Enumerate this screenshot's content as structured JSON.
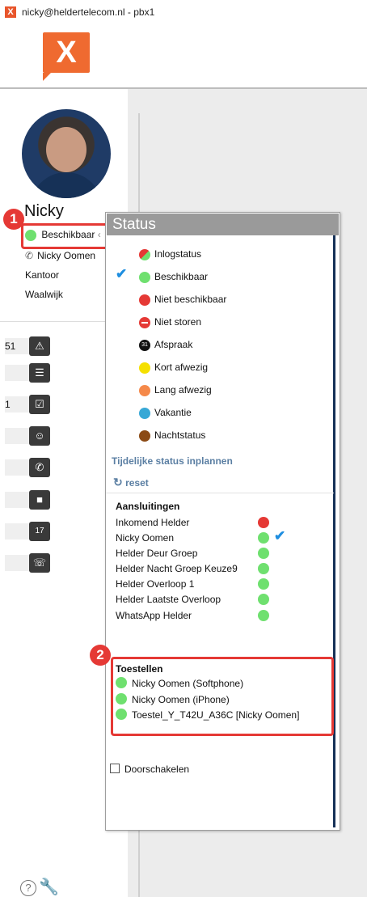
{
  "window": {
    "title": "nicky@heldertelecom.nl - pbx1",
    "app_icon_letter": "X"
  },
  "logo": {
    "letter": "X",
    "color": "#ef6a30"
  },
  "user": {
    "name": "Nicky",
    "status": "Beschikbaar",
    "line": "Nicky Oomen",
    "location": "Kantoor",
    "city": "Waalwijk"
  },
  "markers": {
    "one": "1",
    "two": "2"
  },
  "side_icons": [
    {
      "count": "51",
      "icon": "warning-icon"
    },
    {
      "count": "",
      "icon": "list-icon"
    },
    {
      "count": "1",
      "icon": "checklist-icon"
    },
    {
      "count": "",
      "icon": "contacts-icon"
    },
    {
      "count": "",
      "icon": "phone-icon"
    },
    {
      "count": "",
      "icon": "video-icon"
    },
    {
      "count": "",
      "icon": "calendar-icon"
    },
    {
      "count": "",
      "icon": "desk-phone-icon"
    }
  ],
  "popup": {
    "title": "Status",
    "statuses": [
      {
        "label": "Inlogstatus",
        "color": "#e53935"
      },
      {
        "label": "Beschikbaar",
        "color": "#6fe06f"
      },
      {
        "label": "Niet beschikbaar",
        "color": "#e53935"
      },
      {
        "label": "Niet storen",
        "color": "#e53935"
      },
      {
        "label": "Afspraak",
        "color": "#111111",
        "badge": "31"
      },
      {
        "label": "Kort afwezig",
        "color": "#f5e000"
      },
      {
        "label": "Lang afwezig",
        "color": "#f5894a"
      },
      {
        "label": "Vakantie",
        "color": "#37a8d6"
      },
      {
        "label": "Nachtstatus",
        "color": "#8b4a14"
      }
    ],
    "schedule_link": "Tijdelijke status inplannen",
    "reset_label": "reset",
    "connections_title": "Aansluitingen",
    "connections": [
      {
        "label": "Inkomend Helder",
        "color": "#e53935"
      },
      {
        "label": "Nicky Oomen",
        "color": "#6fe06f"
      },
      {
        "label": "Helder Deur Groep",
        "color": "#6fe06f"
      },
      {
        "label": "Helder Nacht Groep Keuze9",
        "color": "#6fe06f"
      },
      {
        "label": "Helder Overloop 1",
        "color": "#6fe06f"
      },
      {
        "label": "Helder Laatste Overloop",
        "color": "#6fe06f"
      },
      {
        "label": "WhatsApp Helder",
        "color": "#6fe06f"
      }
    ],
    "devices_title": "Toestellen",
    "devices": [
      "Nicky Oomen (Softphone)",
      "Nicky Oomen (iPhone)",
      "Toestel_Y_T42U_A36C [Nicky Oomen]"
    ],
    "forward_label": "Doorschakelen"
  },
  "colors": {
    "accent_red": "#e53935",
    "check_blue": "#1e8ee0",
    "link_blue": "#5b7fa3"
  }
}
